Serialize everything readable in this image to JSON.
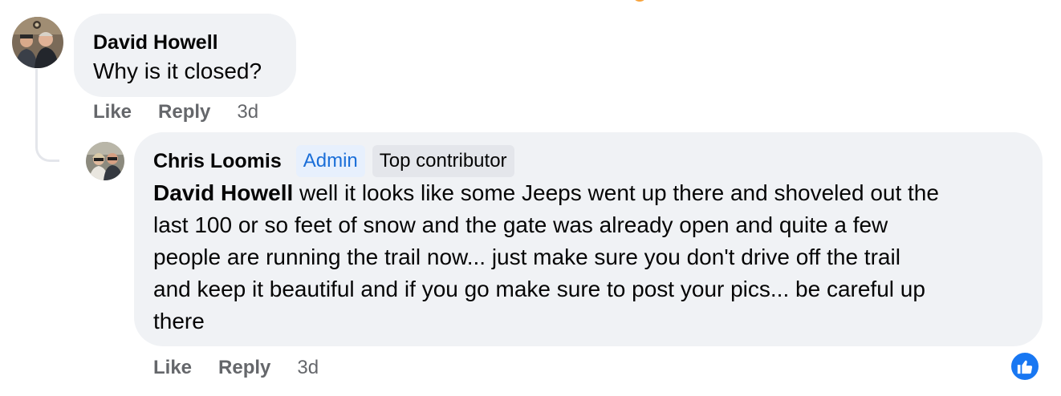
{
  "comments": [
    {
      "author": "David Howell",
      "text": "Why is it closed?",
      "actions": {
        "like": "Like",
        "reply": "Reply",
        "time": "3d"
      }
    },
    {
      "author": "Chris Loomis",
      "badges": {
        "admin": "Admin",
        "top_contributor": "Top contributor"
      },
      "mention": "David Howell",
      "text_lines": [
        " well it looks like some Jeeps went up there and shoveled out the",
        "last 100 or so feet of snow and the gate was already open and quite a few",
        "people are running the trail now... just make sure you don't drive off the trail",
        "and keep it beautiful and if you go make sure to post your pics... be careful up",
        "there"
      ],
      "actions": {
        "like": "Like",
        "reply": "Reply",
        "time": "3d"
      },
      "reaction_icon": "thumbs-up-icon"
    }
  ],
  "colors": {
    "bubble": "#f0f2f5",
    "admin_badge_bg": "#e7f0fd",
    "admin_badge_text": "#1a6ed8",
    "top_badge_bg": "#e4e6eb",
    "meta_text": "#65676b",
    "reaction_blue": "#1877f2"
  }
}
